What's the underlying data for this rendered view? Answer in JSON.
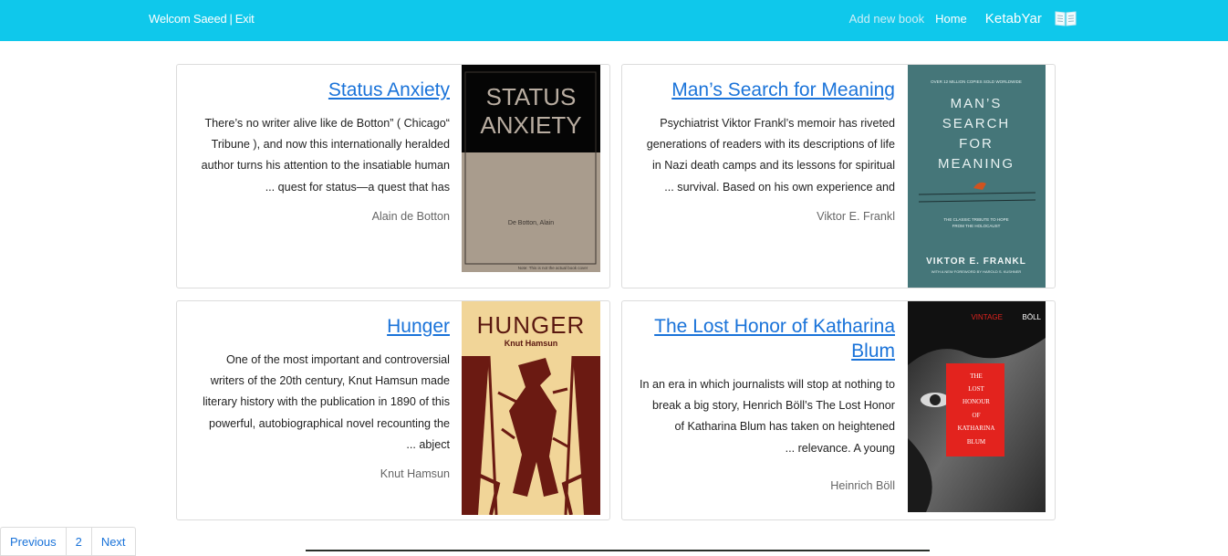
{
  "navbar": {
    "welcome": "Welcom Saeed",
    "separator": "|",
    "exit": "Exit",
    "add_book": "Add new book",
    "home": "Home",
    "brand": "KetabYar",
    "brand_icon": "open-book-icon",
    "bg_color": "#0fc8eb"
  },
  "books": [
    {
      "title": "Status Anxiety",
      "description_lines": [
        "There’s no writer alive like de Botton” ( Chicago“",
        "Tribune ), and now this internationally heralded",
        "author turns his attention to the insatiable human",
        "... quest for status—a quest that has"
      ],
      "author": "Alain de Botton",
      "cover": {
        "line1": "STATUS",
        "line2": "ANXIETY",
        "small": "De Botton, Alain",
        "note": "Note: This is not the actual book cover"
      }
    },
    {
      "title": "Man’s Search for Meaning",
      "description_lines": [
        "Psychiatrist Viktor Frankl’s memoir has riveted",
        "generations of readers with its descriptions of life",
        "in Nazi death camps and its lessons for spiritual",
        "... survival. Based on his own experience and"
      ],
      "author": "Viktor E. Frankl",
      "cover": {
        "top": "OVER 12 MILLION COPIES SOLD WORLDWIDE",
        "t1": "MAN’S",
        "t2": "SEARCH",
        "t3": "FOR",
        "t4": "MEANING",
        "tagline1": "THE CLASSIC TRIBUTE TO HOPE",
        "tagline2": "FROM THE HOLOCAUST",
        "author": "VIKTOR E. FRANKL",
        "foreword": "WITH A NEW FOREWORD BY HAROLD S. KUSHNER"
      }
    },
    {
      "title": "Hunger",
      "description_lines": [
        "One of the most important and controversial",
        "writers of the 20th century, Knut Hamsun made",
        "literary history with the publication in 1890 of this",
        "powerful, autobiographical novel recounting the",
        "... abject"
      ],
      "author": "Knut Hamsun",
      "cover": {
        "title": "HUNGER",
        "author": "Knut Hamsun"
      }
    },
    {
      "title": "The Lost Honor of Katharina Blum",
      "description_lines": [
        "In an era in which journalists will stop at nothing to",
        "break a big story, Henrich Böll’s The Lost Honor",
        "of Katharina Blum has taken on heightened",
        "... relevance. A young"
      ],
      "author": "Heinrich Böll",
      "cover": {
        "brand": "VINTAGE",
        "author": "BÖLL",
        "l1": "THE",
        "l2": "LOST",
        "l3": "HONOUR",
        "l4": "OF",
        "l5": "KATHARINA",
        "l6": "BLUM"
      }
    }
  ],
  "pagination": {
    "previous": "Previous",
    "page": "2",
    "next": "Next"
  }
}
